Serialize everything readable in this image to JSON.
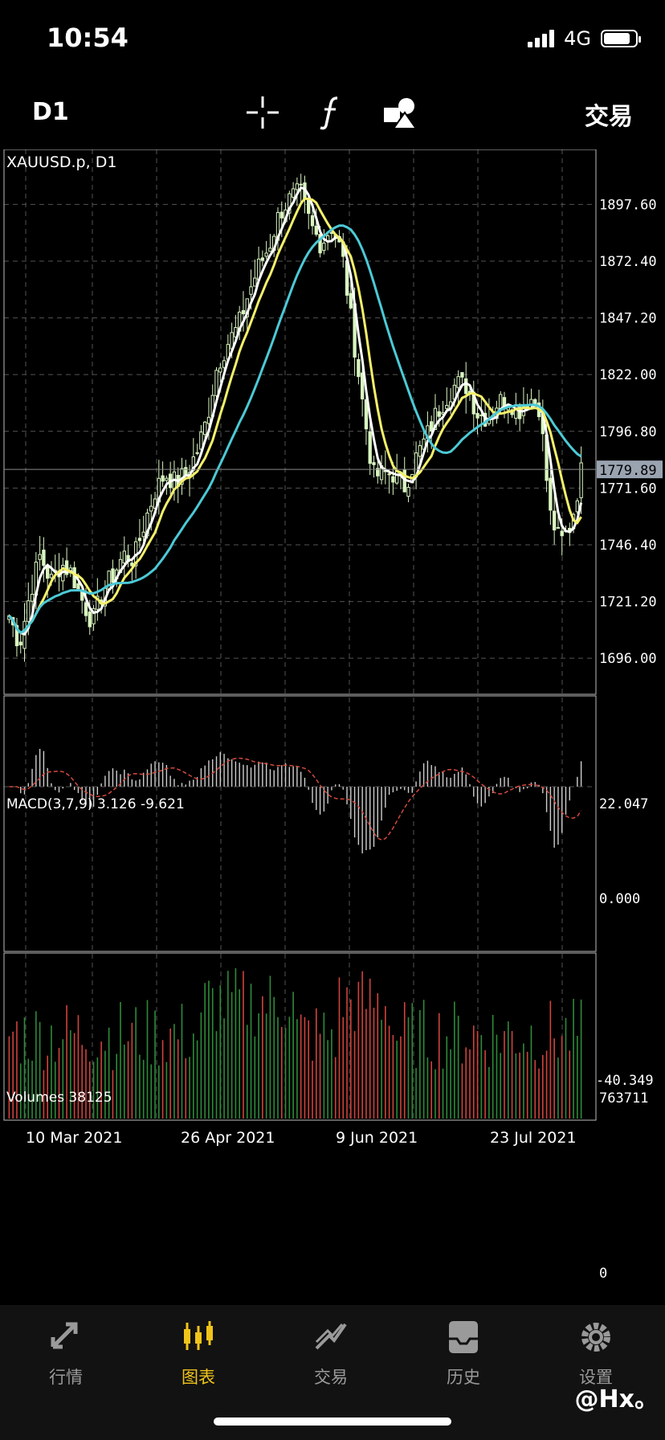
{
  "status": {
    "time": "10:54",
    "network": "4G",
    "battery_level": 0.85
  },
  "toolbar": {
    "period": "D1",
    "trade_label": "交易",
    "icons": [
      "crosshair-icon",
      "indicator-icon",
      "objects-icon"
    ]
  },
  "chart_data": {
    "type": "candlestick",
    "title": "XAUUSD.p, D1",
    "symbol": "XAUUSD.p",
    "timeframe": "D1",
    "x_ticks": [
      "10 Mar 2021",
      "26 Apr 2021",
      "9 Jun 2021",
      "23 Jul 2021"
    ],
    "y_ticks": [
      1897.6,
      1872.4,
      1847.2,
      1822.0,
      1796.8,
      1771.6,
      1746.4,
      1721.2,
      1696.0
    ],
    "ylim": [
      1680.0,
      1922.0
    ],
    "current_price": "1779.89",
    "close_series": [
      1715,
      1702,
      1725,
      1742,
      1730,
      1738,
      1734,
      1722,
      1712,
      1726,
      1733,
      1742,
      1740,
      1756,
      1770,
      1778,
      1774,
      1778,
      1787,
      1802,
      1826,
      1836,
      1843,
      1858,
      1870,
      1879,
      1894,
      1900,
      1903,
      1888,
      1880,
      1888,
      1876,
      1842,
      1809,
      1777,
      1778,
      1778,
      1772,
      1784,
      1793,
      1804,
      1812,
      1818,
      1817,
      1805,
      1803,
      1810,
      1811,
      1806,
      1812,
      1808,
      1760,
      1747,
      1755,
      1779
    ],
    "sma_fast_color": "#ffffff",
    "sma_mid_color": "#f5f06a",
    "sma_slow_color": "#4cc9d6",
    "macd": {
      "label": "MACD(3,7,9) 3.126 -9.621",
      "y_max": "22.047",
      "y_zero": "0.000",
      "y_min": "-40.349"
    },
    "volumes": {
      "label": "Volumes 38125",
      "y_max": "763711",
      "y_min": "0"
    }
  },
  "tabs": [
    {
      "label": "行情",
      "icon": "quotes-icon",
      "active": false
    },
    {
      "label": "图表",
      "icon": "chart-candles-icon",
      "active": true
    },
    {
      "label": "交易",
      "icon": "trade-icon",
      "active": false
    },
    {
      "label": "历史",
      "icon": "history-icon",
      "active": false
    },
    {
      "label": "设置",
      "icon": "gear-icon",
      "active": false
    }
  ],
  "watermark": "@Hx。"
}
